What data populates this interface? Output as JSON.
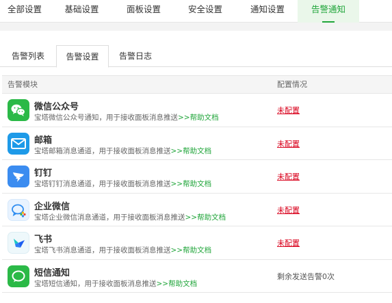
{
  "top_tabs": [
    {
      "label": "全部设置"
    },
    {
      "label": "基础设置"
    },
    {
      "label": "面板设置"
    },
    {
      "label": "安全设置"
    },
    {
      "label": "通知设置"
    },
    {
      "label": "告警通知"
    }
  ],
  "sub_tabs": [
    {
      "label": "告警列表"
    },
    {
      "label": "告警设置"
    },
    {
      "label": "告警日志"
    }
  ],
  "table": {
    "col_module": "告警模块",
    "col_status": "配置情况",
    "help_text": "帮助文档",
    "arrow_text": ">>",
    "rows": [
      {
        "icon": "wechat-official-icon",
        "name": "微信公众号",
        "desc": "宝塔微信公众号通知，用于接收面板消息推送",
        "status": "未配置"
      },
      {
        "icon": "email-icon",
        "name": "邮箱",
        "desc": "宝塔邮箱消息通道，用于接收面板消息推送",
        "status": "未配置"
      },
      {
        "icon": "dingtalk-icon",
        "name": "钉钉",
        "desc": "宝塔钉钉消息通道，用于接收面板消息推送",
        "status": "未配置"
      },
      {
        "icon": "wecom-icon",
        "name": "企业微信",
        "desc": "宝塔企业微信消息通道，用于接收面板消息推送",
        "status": "未配置"
      },
      {
        "icon": "feishu-icon",
        "name": "飞书",
        "desc": "宝塔飞书消息通道，用于接收面板消息推送",
        "status": "未配置"
      },
      {
        "icon": "sms-icon",
        "name": "短信通知",
        "desc": "宝塔短信通知，用于接收面板消息推送",
        "status": "剩余发送告警0次"
      }
    ]
  },
  "colors": {
    "accent": "#20a53a",
    "unconfigured": "#d9001b"
  }
}
